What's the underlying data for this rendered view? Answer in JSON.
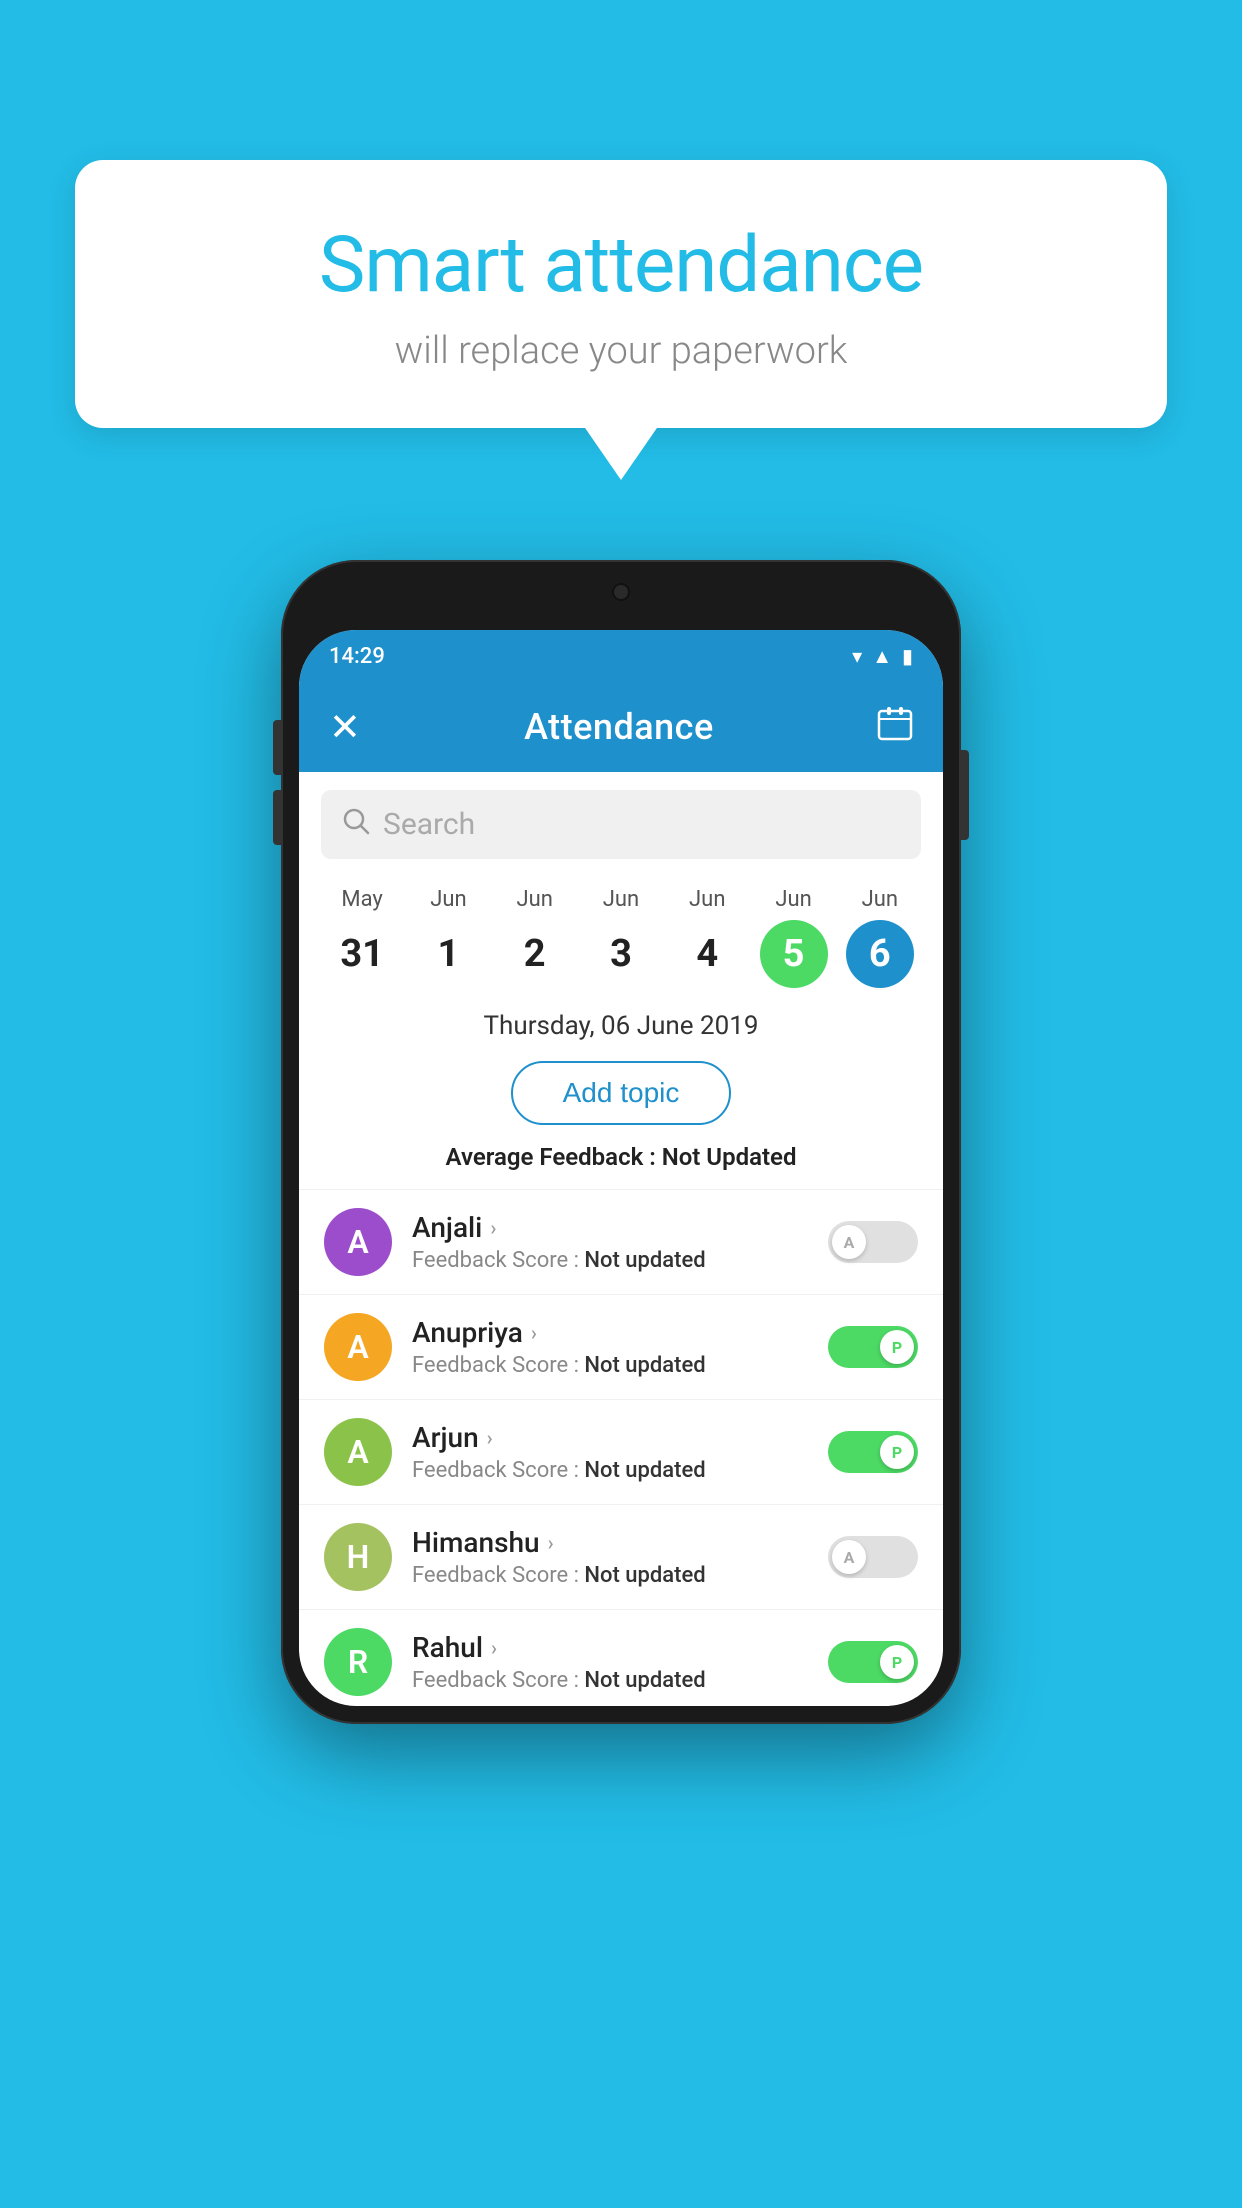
{
  "bubble": {
    "title": "Smart attendance",
    "subtitle": "will replace your paperwork"
  },
  "status_bar": {
    "time": "14:29",
    "icons": [
      "wifi",
      "signal",
      "battery"
    ]
  },
  "header": {
    "close_label": "✕",
    "title": "Attendance",
    "calendar_icon": "📅"
  },
  "search": {
    "placeholder": "Search"
  },
  "calendar": {
    "days": [
      {
        "month": "May",
        "num": "31",
        "state": "normal"
      },
      {
        "month": "Jun",
        "num": "1",
        "state": "normal"
      },
      {
        "month": "Jun",
        "num": "2",
        "state": "normal"
      },
      {
        "month": "Jun",
        "num": "3",
        "state": "normal"
      },
      {
        "month": "Jun",
        "num": "4",
        "state": "normal"
      },
      {
        "month": "Jun",
        "num": "5",
        "state": "today"
      },
      {
        "month": "Jun",
        "num": "6",
        "state": "selected"
      }
    ],
    "selected_date": "Thursday, 06 June 2019"
  },
  "add_topic_label": "Add topic",
  "average_feedback": {
    "label": "Average Feedback : ",
    "value": "Not Updated"
  },
  "students": [
    {
      "name": "Anjali",
      "feedback_label": "Feedback Score : ",
      "feedback_value": "Not updated",
      "avatar_letter": "A",
      "avatar_color": "#9c4dcc",
      "toggle_state": "off",
      "toggle_label": "A"
    },
    {
      "name": "Anupriya",
      "feedback_label": "Feedback Score : ",
      "feedback_value": "Not updated",
      "avatar_letter": "A",
      "avatar_color": "#f5a623",
      "toggle_state": "on",
      "toggle_label": "P"
    },
    {
      "name": "Arjun",
      "feedback_label": "Feedback Score : ",
      "feedback_value": "Not updated",
      "avatar_letter": "A",
      "avatar_color": "#8bc34a",
      "toggle_state": "on",
      "toggle_label": "P"
    },
    {
      "name": "Himanshu",
      "feedback_label": "Feedback Score : ",
      "feedback_value": "Not updated",
      "avatar_letter": "H",
      "avatar_color": "#a5c261",
      "toggle_state": "off",
      "toggle_label": "A"
    },
    {
      "name": "Rahul",
      "feedback_label": "Feedback Score : ",
      "feedback_value": "Not updated",
      "avatar_letter": "R",
      "avatar_color": "#4cd964",
      "toggle_state": "on",
      "toggle_label": "P"
    }
  ]
}
